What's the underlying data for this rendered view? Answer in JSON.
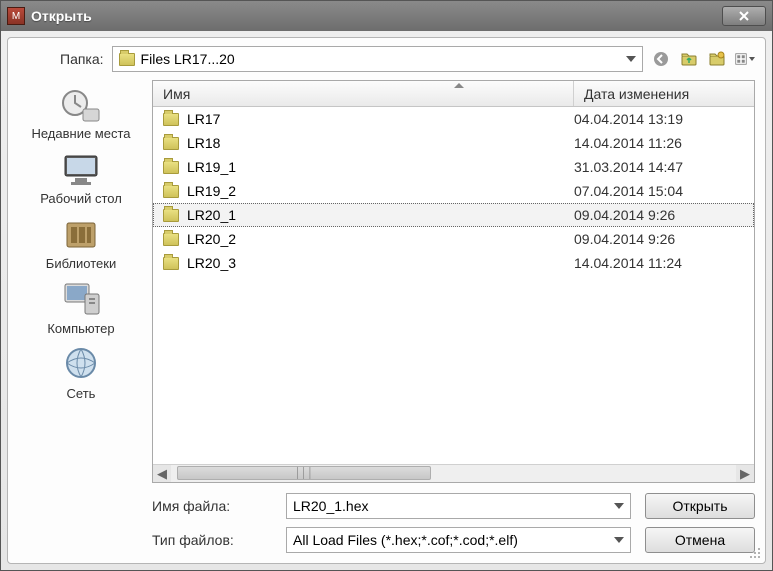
{
  "window": {
    "title": "Открыть"
  },
  "toprow": {
    "label": "Папка:",
    "folder": "Files LR17...20"
  },
  "toolbar_icons": {
    "back": "back-icon",
    "up": "up-folder-icon",
    "new_folder": "new-folder-icon",
    "views": "views-icon"
  },
  "places": [
    {
      "id": "recent",
      "label": "Недавние места"
    },
    {
      "id": "desktop",
      "label": "Рабочий стол"
    },
    {
      "id": "libs",
      "label": "Библиотеки"
    },
    {
      "id": "computer",
      "label": "Компьютер"
    },
    {
      "id": "network",
      "label": "Сеть"
    }
  ],
  "columns": {
    "name": "Имя",
    "date": "Дата изменения"
  },
  "files": [
    {
      "name": "LR17",
      "date": "04.04.2014 13:19",
      "selected": false
    },
    {
      "name": "LR18",
      "date": "14.04.2014 11:26",
      "selected": false
    },
    {
      "name": "LR19_1",
      "date": "31.03.2014 14:47",
      "selected": false
    },
    {
      "name": "LR19_2",
      "date": "07.04.2014 15:04",
      "selected": false
    },
    {
      "name": "LR20_1",
      "date": "09.04.2014 9:26",
      "selected": true
    },
    {
      "name": "LR20_2",
      "date": "09.04.2014 9:26",
      "selected": false
    },
    {
      "name": "LR20_3",
      "date": "14.04.2014 11:24",
      "selected": false
    }
  ],
  "bottom": {
    "filename_label": "Имя файла:",
    "filename_value": "LR20_1.hex",
    "filetype_label": "Тип файлов:",
    "filetype_value": "All Load Files (*.hex;*.cof;*.cod;*.elf)",
    "open_button": "Открыть",
    "cancel_button": "Отмена"
  }
}
